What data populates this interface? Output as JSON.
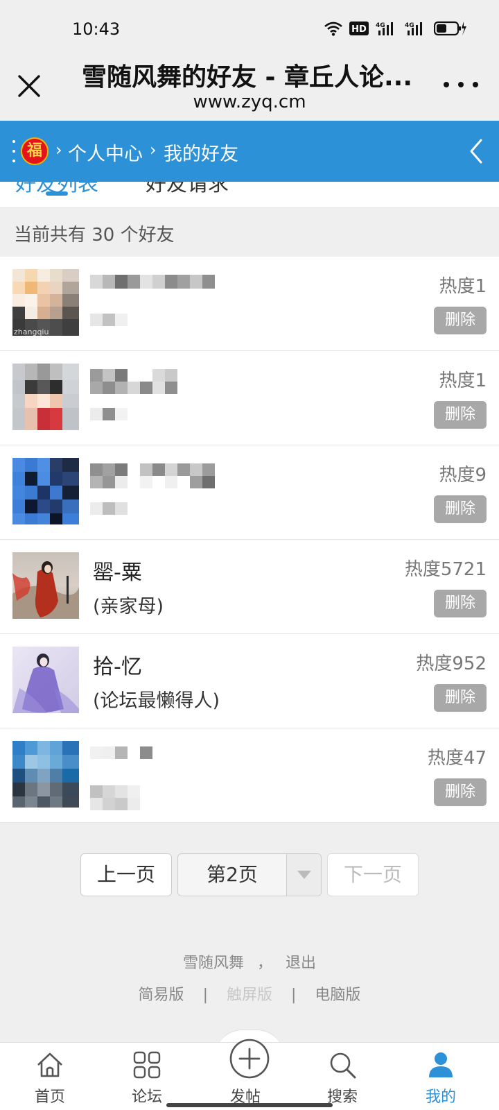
{
  "status_bar": {
    "time": "10:43",
    "network_labels": [
      "HD",
      "4G",
      "4G"
    ]
  },
  "browser": {
    "title": "雪随风舞的好友 - 章丘人论...",
    "url": "www.zyq.cm"
  },
  "site_nav": {
    "badge": "福",
    "separator": "›",
    "breadcrumb": [
      "个人中心",
      "我的好友"
    ]
  },
  "tabs": [
    {
      "label": "好友列表",
      "active": true
    },
    {
      "label": "好友请求",
      "active": false
    }
  ],
  "friend_count": "当前共有 30 个好友",
  "friends": [
    {
      "name": "",
      "note": "",
      "heat": "热度1",
      "delete": "删除"
    },
    {
      "name": "",
      "note": "",
      "heat": "热度1",
      "delete": "删除"
    },
    {
      "name": "",
      "note": "",
      "heat": "热度9",
      "delete": "删除"
    },
    {
      "name": "罂-粟",
      "note": "(亲家母)",
      "heat": "热度5721",
      "delete": "删除"
    },
    {
      "name": "拾-忆",
      "note": "(论坛最懒得人)",
      "heat": "热度952",
      "delete": "删除"
    },
    {
      "name": "",
      "note": "",
      "heat": "热度47",
      "delete": "删除"
    }
  ],
  "avatar_watermark": "zhangqiu",
  "pager": {
    "prev": "上一页",
    "current": "第2页",
    "next": "下一页"
  },
  "footer": {
    "username": "雪随风舞",
    "separator": "，",
    "logout": "退出",
    "links": [
      "简易版",
      "触屏版",
      "电脑版"
    ],
    "link_separator": "|"
  },
  "bottom_nav": [
    {
      "label": "首页",
      "icon": "home-icon"
    },
    {
      "label": "论坛",
      "icon": "grid-icon"
    },
    {
      "label": "发帖",
      "icon": "plus-circle-icon"
    },
    {
      "label": "搜索",
      "icon": "search-icon"
    },
    {
      "label": "我的",
      "icon": "user-icon",
      "active": true
    }
  ],
  "colors": {
    "accent": "#2c91d6",
    "delete_button": "#a8a8a8",
    "badge_red": "#e3131b"
  }
}
